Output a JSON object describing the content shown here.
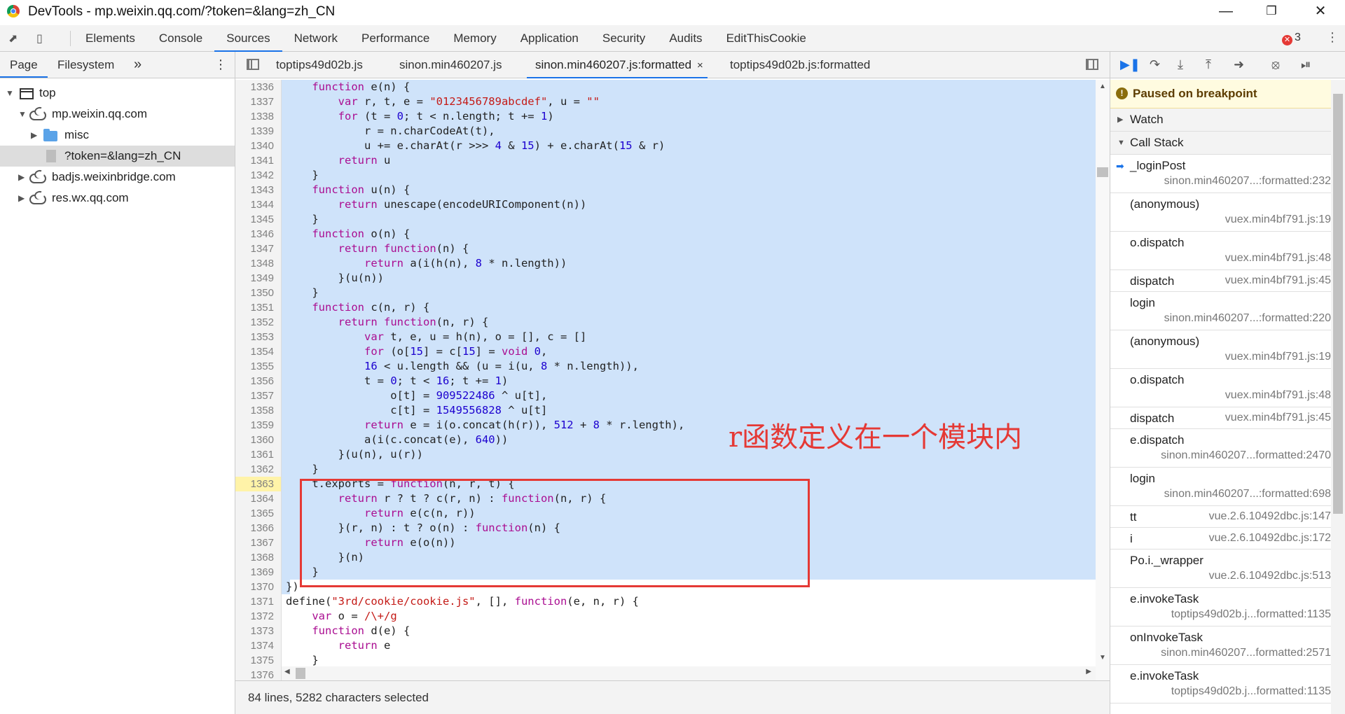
{
  "window": {
    "title": "DevTools - mp.weixin.qq.com/?token=&lang=zh_CN"
  },
  "panel_tabs": [
    "Elements",
    "Console",
    "Sources",
    "Network",
    "Performance",
    "Memory",
    "Application",
    "Security",
    "Audits",
    "EditThisCookie"
  ],
  "active_panel": "Sources",
  "error_count": "3",
  "navigator": {
    "tabs": [
      "Page",
      "Filesystem"
    ],
    "more": "»",
    "tree": [
      "top",
      "mp.weixin.qq.com",
      "misc",
      "?token=&lang=zh_CN",
      "badjs.weixinbridge.com",
      "res.wx.qq.com"
    ]
  },
  "editor": {
    "tabs": [
      "toptips49d02b.js",
      "sinon.min460207.js",
      "sinon.min460207.js:formatted",
      "toptips49d02b.js:formatted"
    ],
    "tab_close": "×",
    "line_numbers": [
      "1336",
      "1337",
      "1338",
      "1339",
      "1340",
      "1341",
      "1342",
      "1343",
      "1344",
      "1345",
      "1346",
      "1347",
      "1348",
      "1349",
      "1350",
      "1351",
      "1352",
      "1353",
      "1354",
      "1355",
      "1356",
      "1357",
      "1358",
      "1359",
      "1360",
      "1361",
      "1362",
      "1363",
      "1364",
      "1365",
      "1366",
      "1367",
      "1368",
      "1369",
      "1370",
      "1371",
      "1372",
      "1373",
      "1374",
      "1375",
      "1376"
    ],
    "status": "84 lines, 5282 characters selected"
  },
  "annotation": "r函数定义在一个模块内",
  "debugger": {
    "paused_text": "Paused on breakpoint",
    "sections": {
      "watch": "Watch",
      "call_stack": "Call Stack"
    },
    "frames": [
      {
        "fn": "_loginPost",
        "loc": "sinon.min460207...:formatted:232"
      },
      {
        "fn": "(anonymous)",
        "loc": "vuex.min4bf791.js:19"
      },
      {
        "fn": "o.dispatch",
        "loc": "vuex.min4bf791.js:48"
      },
      {
        "fn": "dispatch",
        "loc": "vuex.min4bf791.js:45"
      },
      {
        "fn": "login",
        "loc": "sinon.min460207...:formatted:220"
      },
      {
        "fn": "(anonymous)",
        "loc": "vuex.min4bf791.js:19"
      },
      {
        "fn": "o.dispatch",
        "loc": "vuex.min4bf791.js:48"
      },
      {
        "fn": "dispatch",
        "loc": "vuex.min4bf791.js:45"
      },
      {
        "fn": "e.dispatch",
        "loc": "sinon.min460207...formatted:2470"
      },
      {
        "fn": "login",
        "loc": "sinon.min460207...:formatted:698"
      },
      {
        "fn": "tt",
        "loc": "vue.2.6.10492dbc.js:147"
      },
      {
        "fn": "i",
        "loc": "vue.2.6.10492dbc.js:172"
      },
      {
        "fn": "Po.i._wrapper",
        "loc": "vue.2.6.10492dbc.js:513"
      },
      {
        "fn": "e.invokeTask",
        "loc": "toptips49d02b.j...formatted:1135"
      },
      {
        "fn": "onInvokeTask",
        "loc": "sinon.min460207...formatted:2571"
      },
      {
        "fn": "e.invokeTask",
        "loc": "toptips49d02b.j...formatted:1135"
      }
    ]
  }
}
